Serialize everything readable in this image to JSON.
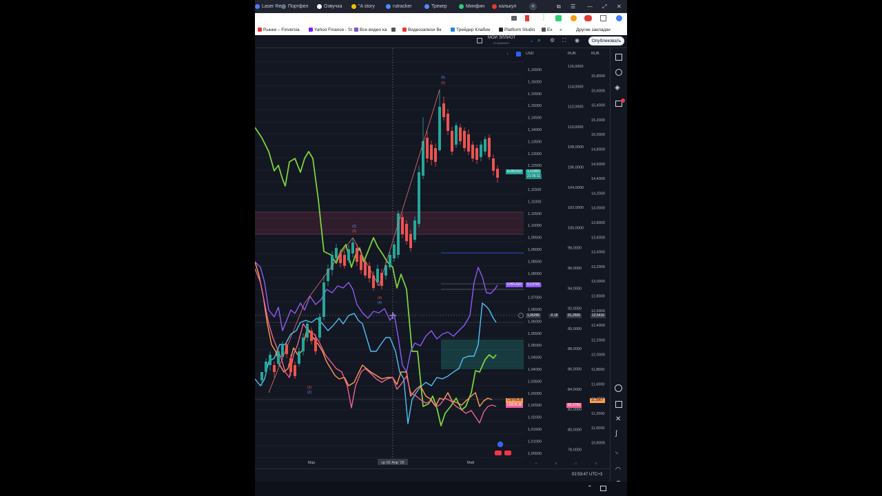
{
  "browser": {
    "tabs": [
      {
        "label": "Laser Re",
        "color": "#4f7cff"
      },
      {
        "label": "Портфел",
        "color": "#6b7280"
      },
      {
        "label": "Озвучка",
        "color": "#ffffff"
      },
      {
        "label": "\"A story",
        "color": "#f2c200"
      },
      {
        "label": "rutracker",
        "color": "#4d8df7"
      },
      {
        "label": "Трекер",
        "color": "#4d8df7"
      },
      {
        "label": "Минфин",
        "color": "#2ecc71"
      },
      {
        "label": "калькул",
        "color": "#e53935"
      }
    ],
    "bookmarks": [
      {
        "label": "Рынки – Finversia",
        "color": "#e53935"
      },
      {
        "label": "Yahoo Finance - St",
        "color": "#7e1fff"
      },
      {
        "label": "Все видео ка",
        "color": "#7e57c2"
      },
      {
        "label": "",
        "color": "#555555"
      },
      {
        "label": "Видеозаписи Вк",
        "color": "#e53935"
      },
      {
        "label": "Трейдер Клабин",
        "color": "#1e88e5"
      },
      {
        "label": "Platform Studio",
        "color": "#222222"
      },
      {
        "label": "Ех",
        "color": "#555555"
      },
      {
        "label": "»",
        "color": ""
      },
      {
        "label": "Другие закладки",
        "color": ""
      }
    ]
  },
  "toolbar": {
    "layout_name": "МОЙ ЭЛЛИОТ",
    "layout_status": "Сохранено",
    "publish_label": "Опубликовать"
  },
  "chart": {
    "scale_left_currency": "USD",
    "scale_mid_currency": "RUB",
    "scale_right_currency": "RUB",
    "axis_eurusd": [
      "1,16500",
      "1,16000",
      "1,15500",
      "1,15000",
      "1,14500",
      "1,14000",
      "1,13500",
      "1,13000",
      "1,12500",
      "1,12000",
      "1,11500",
      "1,11000",
      "1,10500",
      "1,10000",
      "1,09500",
      "1,09000",
      "1,08500",
      "1,08000",
      "1,07500",
      "1,07000",
      "1,06500",
      "1,06000",
      "1,05500",
      "1,05000",
      "1,04500",
      "1,04000",
      "1,03500",
      "1,03000",
      "1,02500",
      "1,02000",
      "1,01500",
      "1,01000",
      "1,00500"
    ],
    "axis_rub_mid": [
      "116,0000",
      "114,0000",
      "112,0000",
      "110,0000",
      "108,0000",
      "106,0000",
      "104,0000",
      "102,0000",
      "100,0000",
      "98,0000",
      "96,0000",
      "94,0000",
      "92,0000",
      "90,0000",
      "88,0000",
      "86,0000",
      "84,0000",
      "82,0000",
      "80,0000",
      "78,0000"
    ],
    "axis_rub_right": [
      "15,8000",
      "15,6000",
      "15,4000",
      "15,2000",
      "15,0000",
      "14,8000",
      "14,6000",
      "14,4000",
      "14,2000",
      "14,0000",
      "13,8000",
      "13,6000",
      "13,4000",
      "13,2000",
      "13,0000",
      "12,8000",
      "12,6000",
      "12,4000",
      "12,2000",
      "12,0000",
      "11,8000",
      "11,6000",
      "11,4000",
      "11,2000",
      "11,0000",
      "10,8000"
    ],
    "tags": {
      "eurusd_name": "EURUSD",
      "eurusd_value": "1,12303",
      "eurusd_timer": "21:06:11",
      "chfusd_name": "CHFUSD",
      "chfusd_value": "0,13793",
      "cross_left": "1,06295",
      "cross_change": "-0,18",
      "cross_mid": "91,2505",
      "cross_right": "12,5416",
      "cnyrub_name": "CNYRUB",
      "usdrub_name": "USDRUB",
      "usdrub_value": "82,3750",
      "cnyrub_value": "11,3967"
    },
    "time_labels": [
      "Мар",
      "ср 02 Апр '25",
      "Май"
    ],
    "wave_labels": {
      "w5": "(5)",
      "w3": "(3)",
      "w4": "(4)",
      "w2": "(2)"
    },
    "colors": {
      "up": "#26a69a",
      "down": "#ef5350",
      "green_line": "#7bd33d",
      "purple_line": "#8f5cf7",
      "cyan_line": "#4fc3f7",
      "orange_line": "#ff9e57",
      "pink_line": "#f06292"
    }
  },
  "status": {
    "clock": "02:53:47 UTC+3",
    "scale_modes": [
      "A",
      "B",
      "C",
      "D"
    ]
  }
}
